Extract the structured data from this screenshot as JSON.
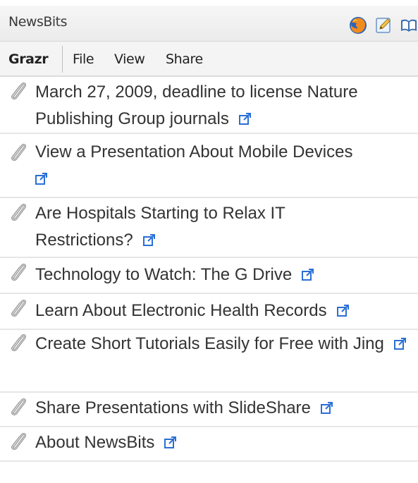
{
  "header": {
    "title": "NewsBits",
    "icons": [
      "firefox-icon",
      "edit-note-icon",
      "book-icon"
    ]
  },
  "menu": {
    "brand": "Grazr",
    "items": [
      "File",
      "View",
      "Share"
    ]
  },
  "items": [
    {
      "title": "March 27, 2009, deadline to license Nature Publishing Group journals"
    },
    {
      "title": "View a Presentation About Mobile Devices"
    },
    {
      "title": "Are Hospitals Starting to Relax IT Restrictions?"
    },
    {
      "title": "Technology to Watch: The G Drive"
    },
    {
      "title": "Learn About Electronic Health Records"
    },
    {
      "title": "Create Short Tutorials Easily for Free with Jing"
    },
    {
      "title": "Share Presentations with SlideShare"
    },
    {
      "title": "About NewsBits"
    }
  ],
  "colors": {
    "link_icon": "#2a6fd6",
    "text": "#333333",
    "divider": "#e6e6e6"
  }
}
